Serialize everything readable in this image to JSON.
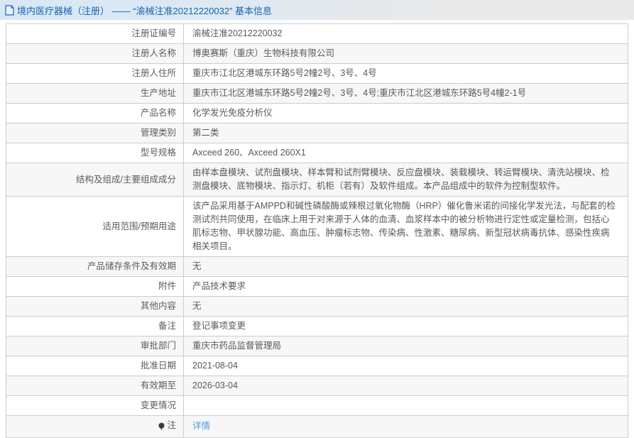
{
  "header": {
    "icon": "document-icon",
    "title": "境内医疗器械（注册） —— “渝械注准20212220032” 基本信息"
  },
  "colors": {
    "header_bg_left": "#d7e7f6",
    "header_bg_right": "#e9e9e9",
    "header_text": "#1464ad",
    "row_alt_bg": "#f7f7f7",
    "border": "#cccccc",
    "body_text": "#595959",
    "link": "#4f9bd5"
  },
  "table": {
    "rows": [
      {
        "label": "注册证编号",
        "value": "渝械注准20212220032"
      },
      {
        "label": "注册人名称",
        "value": "博奥赛斯（重庆）生物科技有限公司"
      },
      {
        "label": "注册人住所",
        "value": "重庆市江北区港城东环路5号2幢2号、3号、4号"
      },
      {
        "label": "生产地址",
        "value": "重庆市江北区港城东环路5号2幢2号、3号、4号;重庆市江北区港城东环路5号4幢2-1号"
      },
      {
        "label": "产品名称",
        "value": "化学发光免疫分析仪"
      },
      {
        "label": "管理类别",
        "value": "第二类"
      },
      {
        "label": "型号规格",
        "value": "Axceed 260、Axceed 260X1"
      },
      {
        "label": "结构及组成/主要组成成分",
        "value": "由样本盘模块、试剂盘模块、样本臂和试剂臂模块、反应盘模块、装载模块、转运臂模块、清洗站模块、检测盘模块、底物模块、指示灯、机柜（若有）及软件组成。本产品组成中的软件为控制型软件。"
      },
      {
        "label": "适用范围/预期用途",
        "value": "该产品采用基于AMPPD和碱性磷酸酶或辣根过氧化物酶（HRP）催化鲁米诺的间接化学发光法，与配套的检测试剂共同使用，在临床上用于对来源于人体的血清、血浆样本中的被分析物进行定性或定量检测，包括心肌标志物、甲状腺功能、高血压、肿瘤标志物、传染病、性激素、糖尿病、新型冠状病毒抗体、感染性疾病相关项目。"
      },
      {
        "label": "产品储存条件及有效期",
        "value": "无"
      },
      {
        "label": "附件",
        "value": "产品技术要求"
      },
      {
        "label": "其他内容",
        "value": "无"
      },
      {
        "label": "备注",
        "value": "登记事项变更"
      },
      {
        "label": "审批部门",
        "value": "重庆市药品监督管理局"
      },
      {
        "label": "批准日期",
        "value": "2021-08-04"
      },
      {
        "label": "有效期至",
        "value": "2026-03-04"
      },
      {
        "label": "变更情况",
        "value": ""
      },
      {
        "label": "注",
        "value": "详情"
      }
    ]
  }
}
